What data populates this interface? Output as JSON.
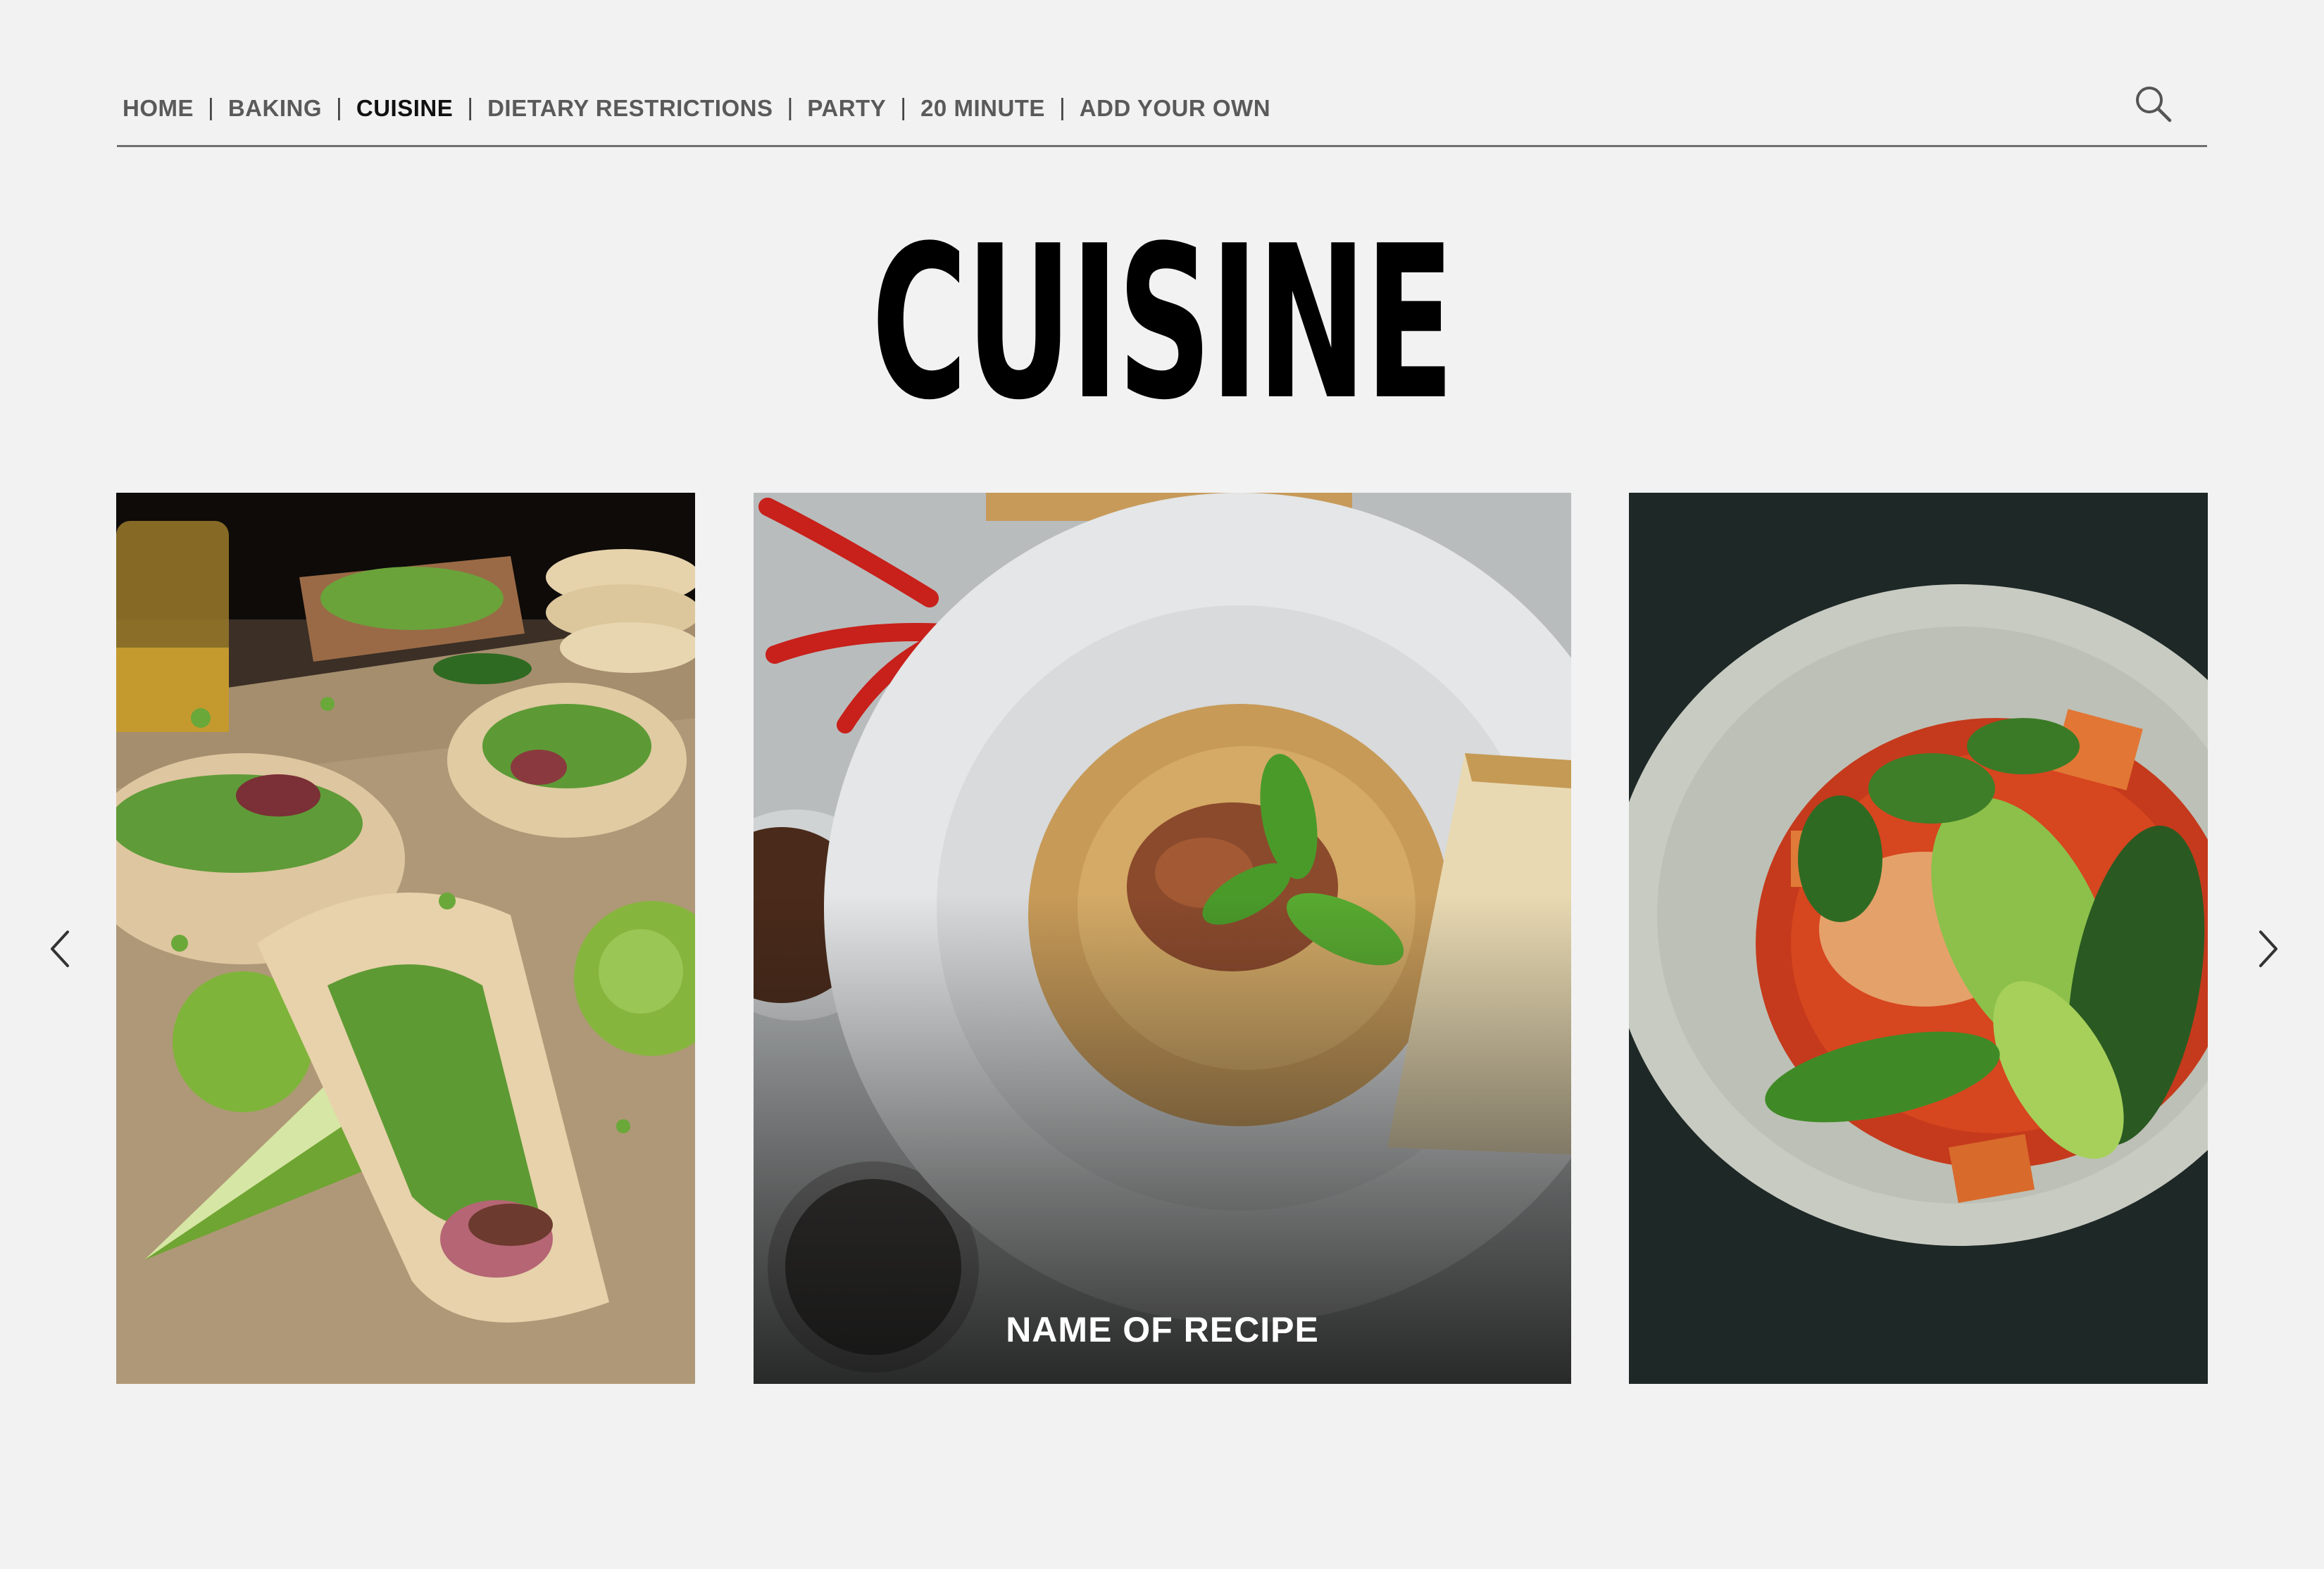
{
  "nav": {
    "items": [
      {
        "label": "HOME",
        "active": false
      },
      {
        "label": "BAKING",
        "active": false
      },
      {
        "label": "CUISINE",
        "active": true
      },
      {
        "label": "DIETARY RESTRICTIONS",
        "active": false
      },
      {
        "label": "PARTY",
        "active": false
      },
      {
        "label": "20 MINUTE",
        "active": false
      },
      {
        "label": "ADD YOUR OWN",
        "active": false
      }
    ],
    "separator": "|",
    "search_icon": "search-icon"
  },
  "page": {
    "title": "CUISINE"
  },
  "carousel": {
    "cards": [
      {
        "image": "tacos-photo",
        "caption": ""
      },
      {
        "image": "spaghetti-photo",
        "caption": "NAME OF RECIPE"
      },
      {
        "image": "curry-noodle-soup-photo",
        "caption": ""
      }
    ],
    "prev_icon": "chevron-left-icon",
    "next_icon": "chevron-right-icon"
  },
  "colors": {
    "background": "#f2f2f2",
    "nav_text": "#5a5a5a",
    "nav_active": "#111111",
    "title": "#000000",
    "caption": "#ffffff"
  }
}
